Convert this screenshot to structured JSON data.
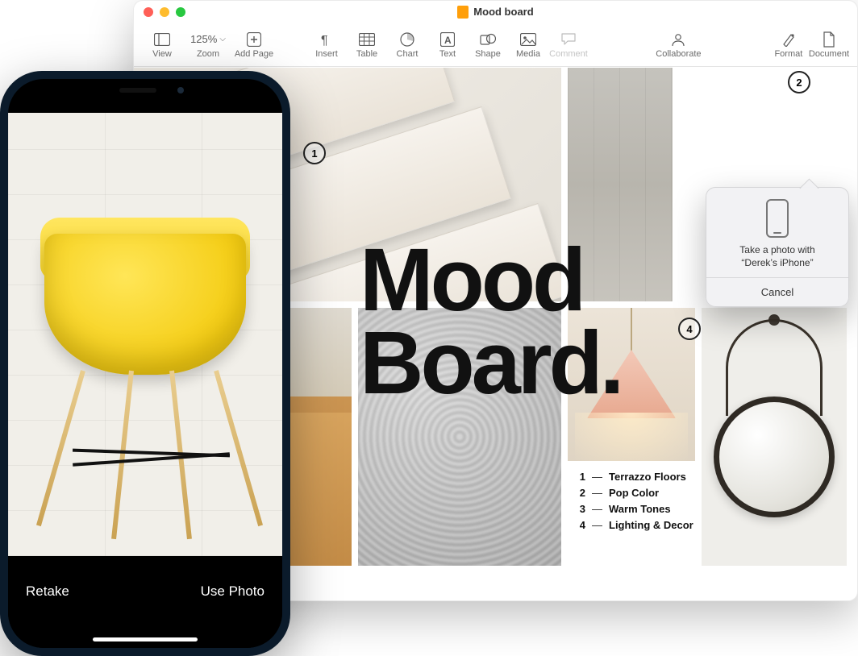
{
  "window": {
    "title": "Mood board"
  },
  "toolbar": {
    "view": "View",
    "zoom_label": "Zoom",
    "zoom_value": "125%",
    "add_page": "Add Page",
    "insert": "Insert",
    "table": "Table",
    "chart": "Chart",
    "text": "Text",
    "shape": "Shape",
    "media": "Media",
    "comment": "Comment",
    "collaborate": "Collaborate",
    "format": "Format",
    "document": "Document"
  },
  "document": {
    "heading_line1": "Mood",
    "heading_line2": "Board.",
    "legend": [
      {
        "num": "1",
        "label": "Terrazzo Floors"
      },
      {
        "num": "2",
        "label": "Pop Color"
      },
      {
        "num": "3",
        "label": "Warm Tones"
      },
      {
        "num": "4",
        "label": "Lighting & Decor"
      }
    ],
    "annotations": {
      "a1": "1",
      "a2": "2",
      "a4": "4"
    }
  },
  "popover": {
    "text_line1": "Take a photo with",
    "text_line2": "“Derek’s iPhone”",
    "cancel": "Cancel"
  },
  "iphone": {
    "retake": "Retake",
    "use_photo": "Use Photo"
  }
}
